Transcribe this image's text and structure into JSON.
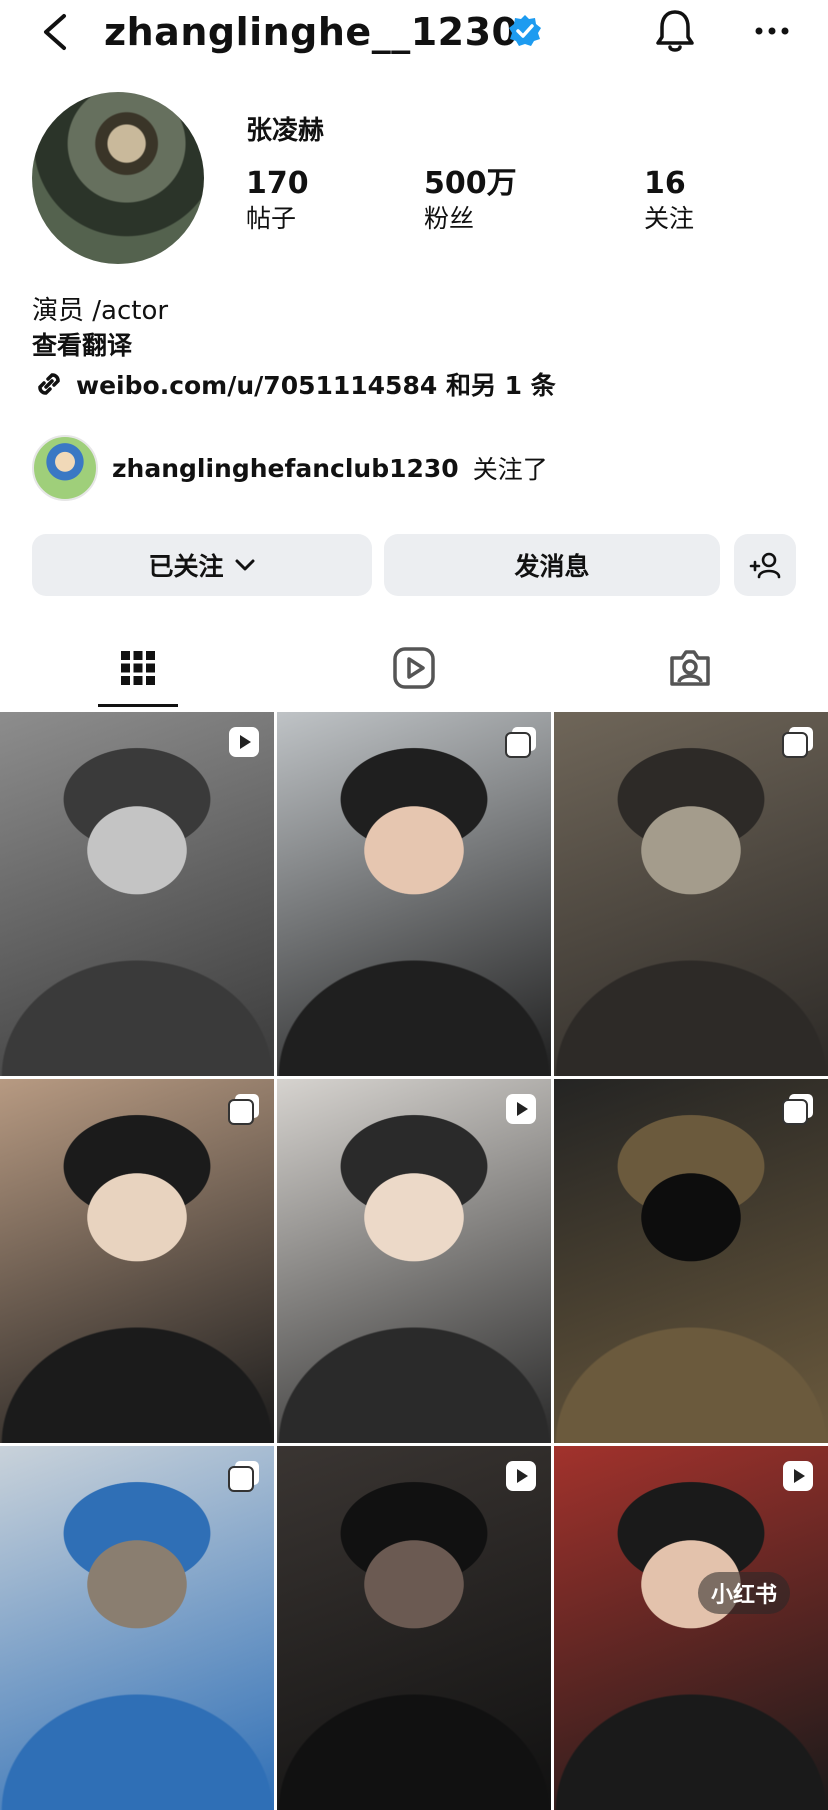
{
  "header": {
    "username": "zhanglinghe__1230"
  },
  "profile": {
    "display_name": "张凌赫",
    "stats": [
      {
        "value": "170",
        "label": "帖子"
      },
      {
        "value": "500万",
        "label": "粉丝"
      },
      {
        "value": "16",
        "label": "关注"
      }
    ],
    "bio": "演员 /actor",
    "translate": "查看翻译",
    "link": "weibo.com/u/7051114584 和另 1 条"
  },
  "mutual": {
    "name": "zhanglinghefanclub1230",
    "suffix": "关注了"
  },
  "buttons": {
    "following": "已关注",
    "message": "发消息"
  },
  "grid": [
    {
      "badge": "reel-icon",
      "colors": [
        "#8d8d8d",
        "#3a3a3a",
        "#c4c4c4"
      ]
    },
    {
      "badge": "carousel-icon",
      "colors": [
        "#bfc3c6",
        "#1f1f1f",
        "#e6c6b0"
      ]
    },
    {
      "badge": "carousel-icon",
      "colors": [
        "#6f6659",
        "#2d2a27",
        "#a49c8c"
      ]
    },
    {
      "badge": "carousel-icon",
      "colors": [
        "#b79a82",
        "#1b1b1b",
        "#e8d3bf"
      ]
    },
    {
      "badge": "reel-icon",
      "colors": [
        "#d6d3cf",
        "#2a2a2a",
        "#ecd9c8"
      ]
    },
    {
      "badge": "carousel-icon",
      "colors": [
        "#242423",
        "#6b5a3d",
        "#0d0d0d"
      ]
    },
    {
      "badge": "carousel-icon",
      "colors": [
        "#c9d2da",
        "#2f6fb6",
        "#8a7e70"
      ]
    },
    {
      "badge": "reel-icon",
      "colors": [
        "#3a3532",
        "#111111",
        "#6b5a52"
      ]
    },
    {
      "badge": "reel-icon",
      "colors": [
        "#a2322c",
        "#1a1a1a",
        "#e3c2ac"
      ]
    }
  ],
  "watermark": "小红书"
}
